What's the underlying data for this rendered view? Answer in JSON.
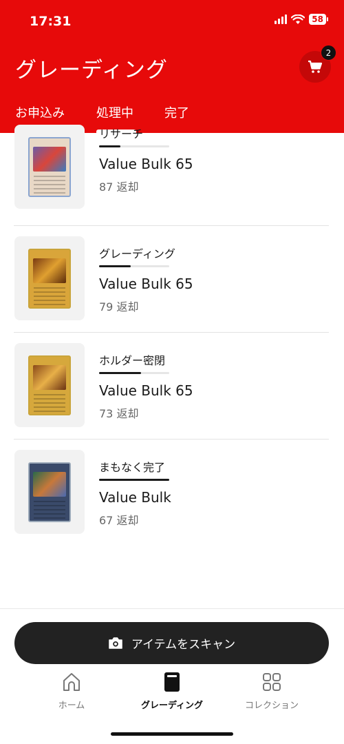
{
  "status_bar": {
    "time": "17:31",
    "battery": "58"
  },
  "header": {
    "title": "グレーディング",
    "cart_count": "2"
  },
  "tabs": [
    {
      "label": "お申込み",
      "active": false
    },
    {
      "label": "処理中",
      "active": true
    },
    {
      "label": "完了",
      "active": false
    }
  ],
  "items": [
    {
      "status": "リサーチ",
      "progress": 0.3,
      "name": "Value Bulk 65",
      "return_count": "87 返却"
    },
    {
      "status": "グレーディング",
      "progress": 0.45,
      "name": "Value Bulk 65",
      "return_count": "79 返却"
    },
    {
      "status": "ホルダー密閉",
      "progress": 0.6,
      "name": "Value Bulk 65",
      "return_count": "73 返却"
    },
    {
      "status": "まもなく完了",
      "progress": 1.0,
      "name": "Value Bulk",
      "return_count": "67 返却"
    }
  ],
  "scan_button": {
    "label": "アイテムをスキャン"
  },
  "bottom_nav": [
    {
      "label": "ホーム",
      "icon": "home-icon",
      "active": false
    },
    {
      "label": "グレーディング",
      "icon": "grading-slab-icon",
      "active": true
    },
    {
      "label": "コレクション",
      "icon": "grid-icon",
      "active": false
    }
  ],
  "colors": {
    "brand_red": "#e70a0a",
    "dark": "#222222"
  }
}
